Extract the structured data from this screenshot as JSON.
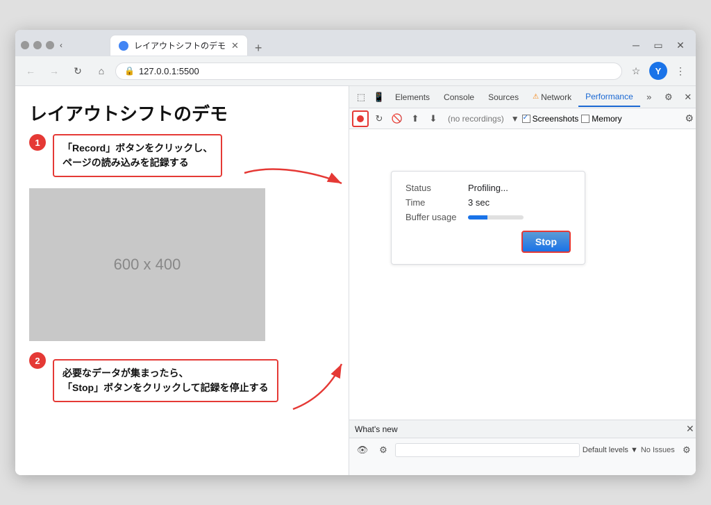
{
  "browser": {
    "tab_title": "レイアウトシフトのデモ",
    "url": "127.0.0.1:5500",
    "new_tab_icon": "+",
    "back_icon": "←",
    "forward_icon": "→",
    "refresh_icon": "↻",
    "home_icon": "⌂",
    "star_icon": "☆",
    "lock_icon": "🔒",
    "more_icon": "⋮"
  },
  "page": {
    "title": "レイアウトシフトのデモ",
    "placeholder_label": "600 x 400",
    "step1_number": "1",
    "step1_text": "「Record」ボタンをクリックし、\nページの読み込みを記録する",
    "step2_number": "2",
    "step2_text": "必要なデータが集まったら、\n「Stop」ボタンをクリックして記録を停止する"
  },
  "devtools": {
    "tabs": [
      "Elements",
      "Console",
      "Sources",
      "Network",
      "Performance"
    ],
    "active_tab": "Performance",
    "toolbar": {
      "recordings_placeholder": "(no recordings)",
      "screenshots_label": "Screenshots",
      "memory_label": "Memory"
    },
    "profiling": {
      "status_label": "Status",
      "status_value": "Profiling...",
      "time_label": "Time",
      "time_value": "3 sec",
      "buffer_label": "Buffer usage",
      "buffer_percent": 35,
      "stop_button_label": "Stop"
    },
    "whatsnew": {
      "title": "What's new",
      "filter_placeholder": "",
      "levels_label": "Default levels ▼",
      "no_issues_label": "No Issues"
    }
  }
}
